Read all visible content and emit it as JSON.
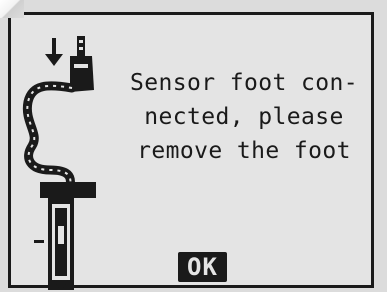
{
  "dialog": {
    "message": "Sensor foot con-\nnected, please\nremove the foot",
    "ok_label": "OK"
  },
  "icons": {
    "illustration": "sensor-foot-cable-icon",
    "arrow": "down-arrow-icon"
  },
  "colors": {
    "screen_background": "#e4e4e4",
    "ink": "#1a1a1a"
  }
}
